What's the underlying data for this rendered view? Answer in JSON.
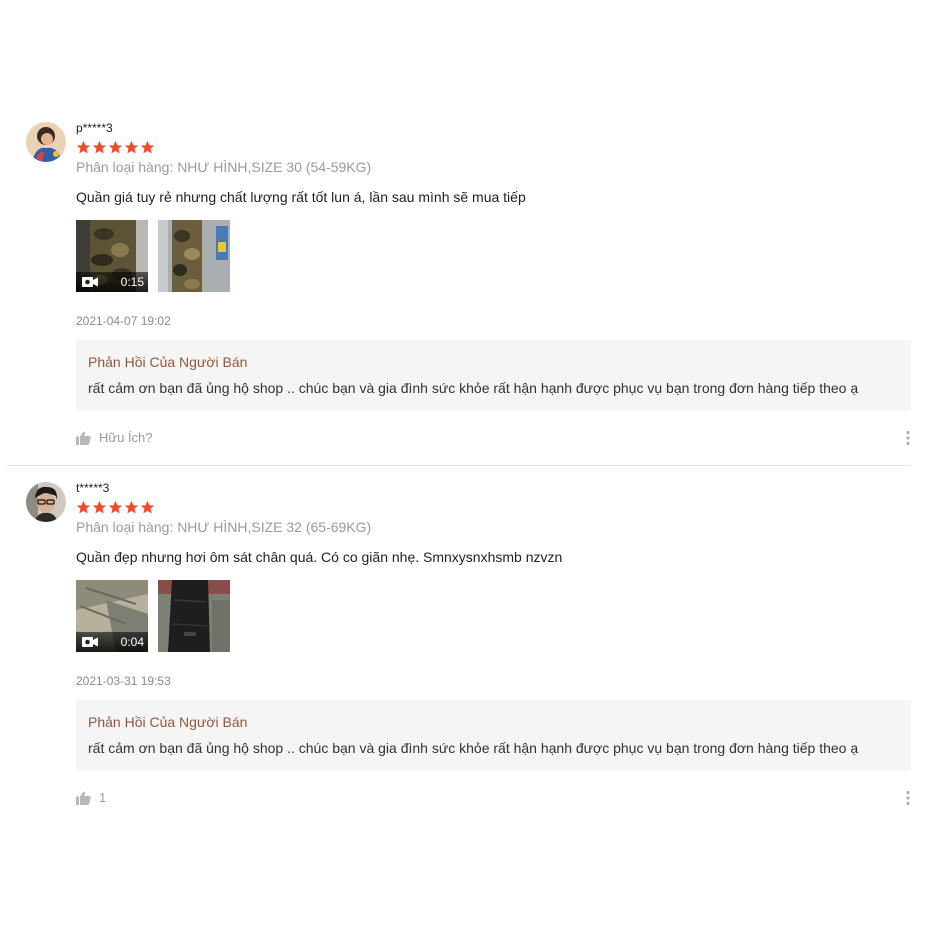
{
  "colors": {
    "star": "#ee4d2d",
    "reply_title": "#8b5a3c",
    "reply_bg": "#f5f5f5"
  },
  "reviews": [
    {
      "username": "p*****3",
      "rating": 5,
      "variant": "Phân loại hàng: NHƯ HÌNH,SIZE 30 (54-59KG)",
      "comment": "Quần giá tuy rẻ nhưng chất lượng rất tốt lun á, lần sau mình sẽ mua tiếp",
      "media": [
        {
          "type": "video",
          "duration": "0:15",
          "icon": "video-camera-icon"
        },
        {
          "type": "image"
        }
      ],
      "time": "2021-04-07 19:02",
      "seller_reply": {
        "title": "Phản Hồi Của Người Bán",
        "text": "rất cảm ơn bạn đã ủng hộ shop .. chúc bạn và gia đình sức khỏe rất hận hạnh được phục vụ bạn trong đơn hàng tiếp theo ạ"
      },
      "like_label": "Hữu Ích?"
    },
    {
      "username": "t*****3",
      "rating": 5,
      "variant": "Phân loại hàng: NHƯ HÌNH,SIZE 32 (65-69KG)",
      "comment": "Quần đẹp nhưng hơi ôm sát chân quá. Có co giãn nhẹ. Smnxysnxhsmb nzvzn",
      "media": [
        {
          "type": "video",
          "duration": "0:04",
          "icon": "video-camera-icon"
        },
        {
          "type": "image"
        }
      ],
      "time": "2021-03-31 19:53",
      "seller_reply": {
        "title": "Phản Hồi Của Người Bán",
        "text": "rất cảm ơn bạn đã ủng hộ shop .. chúc bạn và gia đình sức khỏe rất hận hạnh được phục vụ bạn trong đơn hàng tiếp theo ạ"
      },
      "like_label": "1"
    }
  ]
}
